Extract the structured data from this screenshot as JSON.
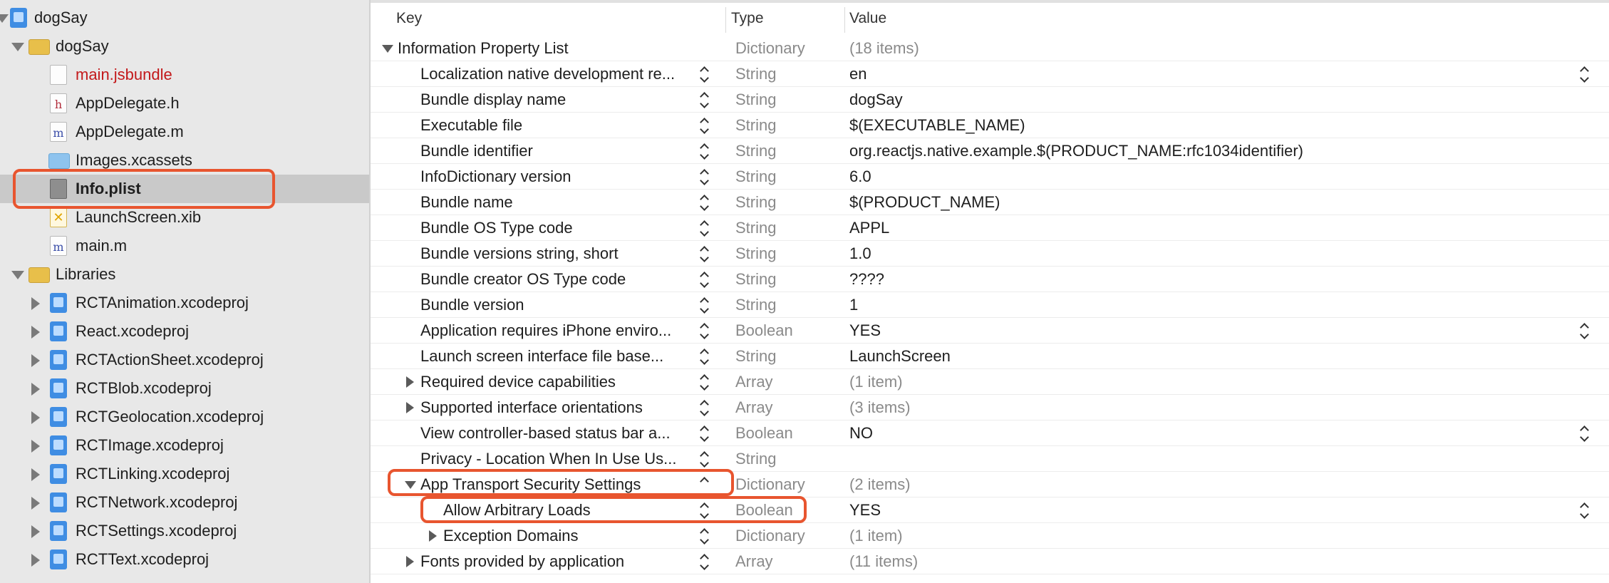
{
  "navigator": {
    "items": [
      {
        "label": "dogSay",
        "icon": "project-icon",
        "disclosure": "down"
      },
      {
        "label": "dogSay",
        "icon": "folder-icon",
        "disclosure": "down"
      },
      {
        "label": "main.jsbundle",
        "icon": "file-icon",
        "color": "#c3191b"
      },
      {
        "label": "AppDelegate.h",
        "icon": "header-file-icon"
      },
      {
        "label": "AppDelegate.m",
        "icon": "objc-file-icon"
      },
      {
        "label": "Images.xcassets",
        "icon": "asset-catalog-icon"
      },
      {
        "label": "Info.plist",
        "icon": "plist-icon",
        "selected": true
      },
      {
        "label": "LaunchScreen.xib",
        "icon": "xib-icon"
      },
      {
        "label": "main.m",
        "icon": "objc-file-icon"
      },
      {
        "label": "Libraries",
        "icon": "folder-icon",
        "disclosure": "down"
      },
      {
        "label": "RCTAnimation.xcodeproj",
        "icon": "project-icon",
        "disclosure": "right"
      },
      {
        "label": "React.xcodeproj",
        "icon": "project-icon",
        "disclosure": "right"
      },
      {
        "label": "RCTActionSheet.xcodeproj",
        "icon": "project-icon",
        "disclosure": "right"
      },
      {
        "label": "RCTBlob.xcodeproj",
        "icon": "project-icon",
        "disclosure": "right"
      },
      {
        "label": "RCTGeolocation.xcodeproj",
        "icon": "project-icon",
        "disclosure": "right"
      },
      {
        "label": "RCTImage.xcodeproj",
        "icon": "project-icon",
        "disclosure": "right"
      },
      {
        "label": "RCTLinking.xcodeproj",
        "icon": "project-icon",
        "disclosure": "right"
      },
      {
        "label": "RCTNetwork.xcodeproj",
        "icon": "project-icon",
        "disclosure": "right"
      },
      {
        "label": "RCTSettings.xcodeproj",
        "icon": "project-icon",
        "disclosure": "right"
      },
      {
        "label": "RCTText.xcodeproj",
        "icon": "project-icon",
        "disclosure": "right"
      }
    ]
  },
  "editor": {
    "columns": {
      "key": "Key",
      "type": "Type",
      "value": "Value"
    },
    "rows": [
      {
        "key": "Information Property List",
        "type": "Dictionary",
        "value": "(18 items)"
      },
      {
        "key": "Localization native development re...",
        "type": "String",
        "value": "en"
      },
      {
        "key": "Bundle display name",
        "type": "String",
        "value": "dogSay"
      },
      {
        "key": "Executable file",
        "type": "String",
        "value": "$(EXECUTABLE_NAME)"
      },
      {
        "key": "Bundle identifier",
        "type": "String",
        "value": "org.reactjs.native.example.$(PRODUCT_NAME:rfc1034identifier)"
      },
      {
        "key": "InfoDictionary version",
        "type": "String",
        "value": "6.0"
      },
      {
        "key": "Bundle name",
        "type": "String",
        "value": "$(PRODUCT_NAME)"
      },
      {
        "key": "Bundle OS Type code",
        "type": "String",
        "value": "APPL"
      },
      {
        "key": "Bundle versions string, short",
        "type": "String",
        "value": "1.0"
      },
      {
        "key": "Bundle creator OS Type code",
        "type": "String",
        "value": "????"
      },
      {
        "key": "Bundle version",
        "type": "String",
        "value": "1"
      },
      {
        "key": "Application requires iPhone enviro...",
        "type": "Boolean",
        "value": "YES"
      },
      {
        "key": "Launch screen interface file base...",
        "type": "String",
        "value": "LaunchScreen"
      },
      {
        "key": "Required device capabilities",
        "type": "Array",
        "value": "(1 item)"
      },
      {
        "key": "Supported interface orientations",
        "type": "Array",
        "value": "(3 items)"
      },
      {
        "key": "View controller-based status bar a...",
        "type": "Boolean",
        "value": "NO"
      },
      {
        "key": "Privacy - Location When In Use Us...",
        "type": "String",
        "value": ""
      },
      {
        "key": "App Transport Security Settings",
        "type": "Dictionary",
        "value": "(2 items)"
      },
      {
        "key": "Allow Arbitrary Loads",
        "type": "Boolean",
        "value": "YES"
      },
      {
        "key": "Exception Domains",
        "type": "Dictionary",
        "value": "(1 item)"
      },
      {
        "key": "Fonts provided by application",
        "type": "Array",
        "value": "(11 items)"
      }
    ]
  },
  "colors": {
    "highlight": "#e8552f",
    "selection": "#c9c9c9",
    "sidebar": "#e8e8e8"
  }
}
